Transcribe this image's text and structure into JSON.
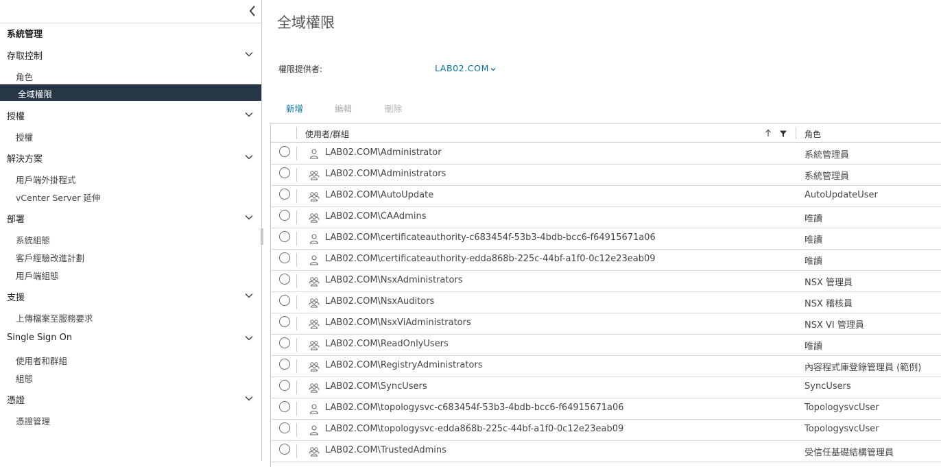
{
  "sidebar": {
    "title": "系統管理",
    "sections": [
      {
        "label": "存取控制",
        "items": [
          "角色",
          "全域權限"
        ]
      },
      {
        "label": "授權",
        "items": [
          "授權"
        ]
      },
      {
        "label": "解決方案",
        "items": [
          "用戶端外掛程式",
          "vCenter Server 延伸"
        ]
      },
      {
        "label": "部署",
        "items": [
          "系統組態",
          "客戶經驗改進計劃",
          "用戶端組態"
        ]
      },
      {
        "label": "支援",
        "items": [
          "上傳檔案至服務要求"
        ]
      },
      {
        "label": "Single Sign On",
        "items": [
          "使用者和群組",
          "組態"
        ]
      },
      {
        "label": "憑證",
        "items": [
          "憑證管理"
        ]
      }
    ],
    "active_item": "全域權限"
  },
  "main": {
    "title": "全域權限",
    "provider_label": "權限提供者:",
    "provider_value": "LAB02.COM",
    "actions": {
      "add": "新增",
      "edit": "編輯",
      "delete": "刪除"
    },
    "grid": {
      "columns": [
        "使用者/群組",
        "角色"
      ],
      "rows": [
        {
          "type": "user",
          "name": "LAB02.COM\\Administrator",
          "role": "系統管理員"
        },
        {
          "type": "group",
          "name": "LAB02.COM\\Administrators",
          "role": "系統管理員"
        },
        {
          "type": "group",
          "name": "LAB02.COM\\AutoUpdate",
          "role": "AutoUpdateUser"
        },
        {
          "type": "group",
          "name": "LAB02.COM\\CAAdmins",
          "role": "唯讀"
        },
        {
          "type": "user",
          "name": "LAB02.COM\\certificateauthority-c683454f-53b3-4bdb-bcc6-f64915671a06",
          "role": "唯讀"
        },
        {
          "type": "user",
          "name": "LAB02.COM\\certificateauthority-edda868b-225c-44bf-a1f0-0c12e23eab09",
          "role": "唯讀"
        },
        {
          "type": "group",
          "name": "LAB02.COM\\NsxAdministrators",
          "role": "NSX 管理員"
        },
        {
          "type": "group",
          "name": "LAB02.COM\\NsxAuditors",
          "role": "NSX 稽核員"
        },
        {
          "type": "group",
          "name": "LAB02.COM\\NsxViAdministrators",
          "role": "NSX VI 管理員"
        },
        {
          "type": "group",
          "name": "LAB02.COM\\ReadOnlyUsers",
          "role": "唯讀"
        },
        {
          "type": "group",
          "name": "LAB02.COM\\RegistryAdministrators",
          "role": "內容程式庫登錄管理員 (範例)"
        },
        {
          "type": "group",
          "name": "LAB02.COM\\SyncUsers",
          "role": "SyncUsers"
        },
        {
          "type": "user",
          "name": "LAB02.COM\\topologysvc-c683454f-53b3-4bdb-bcc6-f64915671a06",
          "role": "TopologysvcUser"
        },
        {
          "type": "user",
          "name": "LAB02.COM\\topologysvc-edda868b-225c-44bf-a1f0-0c12e23eab09",
          "role": "TopologysvcUser"
        },
        {
          "type": "group",
          "name": "LAB02.COM\\TrustedAdmins",
          "role": "受信任基礎結構管理員"
        }
      ]
    }
  },
  "colors": {
    "active_bg": "#253746",
    "link": "#0072a3",
    "disabled": "#b3b3b3"
  }
}
